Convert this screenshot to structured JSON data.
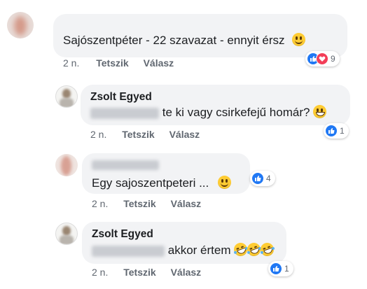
{
  "comments": [
    {
      "author": "",
      "text": "Sajószentpéter  -  22  szavazat  -  ennyit  érsz",
      "time": "2 n.",
      "like_label": "Tetszik",
      "reply_label": "Válasz",
      "reaction_count": "9",
      "reaction_icons": [
        "like-icon",
        "love-icon"
      ]
    },
    {
      "author": "Zsolt Egyed",
      "text": "te ki vagy csirkefejű homár?",
      "time": "2 n.",
      "like_label": "Tetszik",
      "reply_label": "Válasz",
      "reaction_count": "1",
      "reaction_icons": [
        "like-icon"
      ]
    },
    {
      "author": "",
      "text": "Egy  sajoszentpeteri ...",
      "time": "2 n.",
      "like_label": "Tetszik",
      "reply_label": "Válasz",
      "reaction_count": "4",
      "reaction_icons": [
        "like-icon"
      ]
    },
    {
      "author": "Zsolt Egyed",
      "text": "akkor értem",
      "time": "2 n.",
      "like_label": "Tetszik",
      "reply_label": "Válasz",
      "reaction_count": "1",
      "reaction_icons": [
        "like-icon"
      ]
    }
  ],
  "colors": {
    "bubble": "#f2f3f5",
    "like_blue": "#2078f4",
    "love_red": "#f33e58",
    "action_gray": "#606770",
    "emoji_yellow": "#ffcc33"
  }
}
